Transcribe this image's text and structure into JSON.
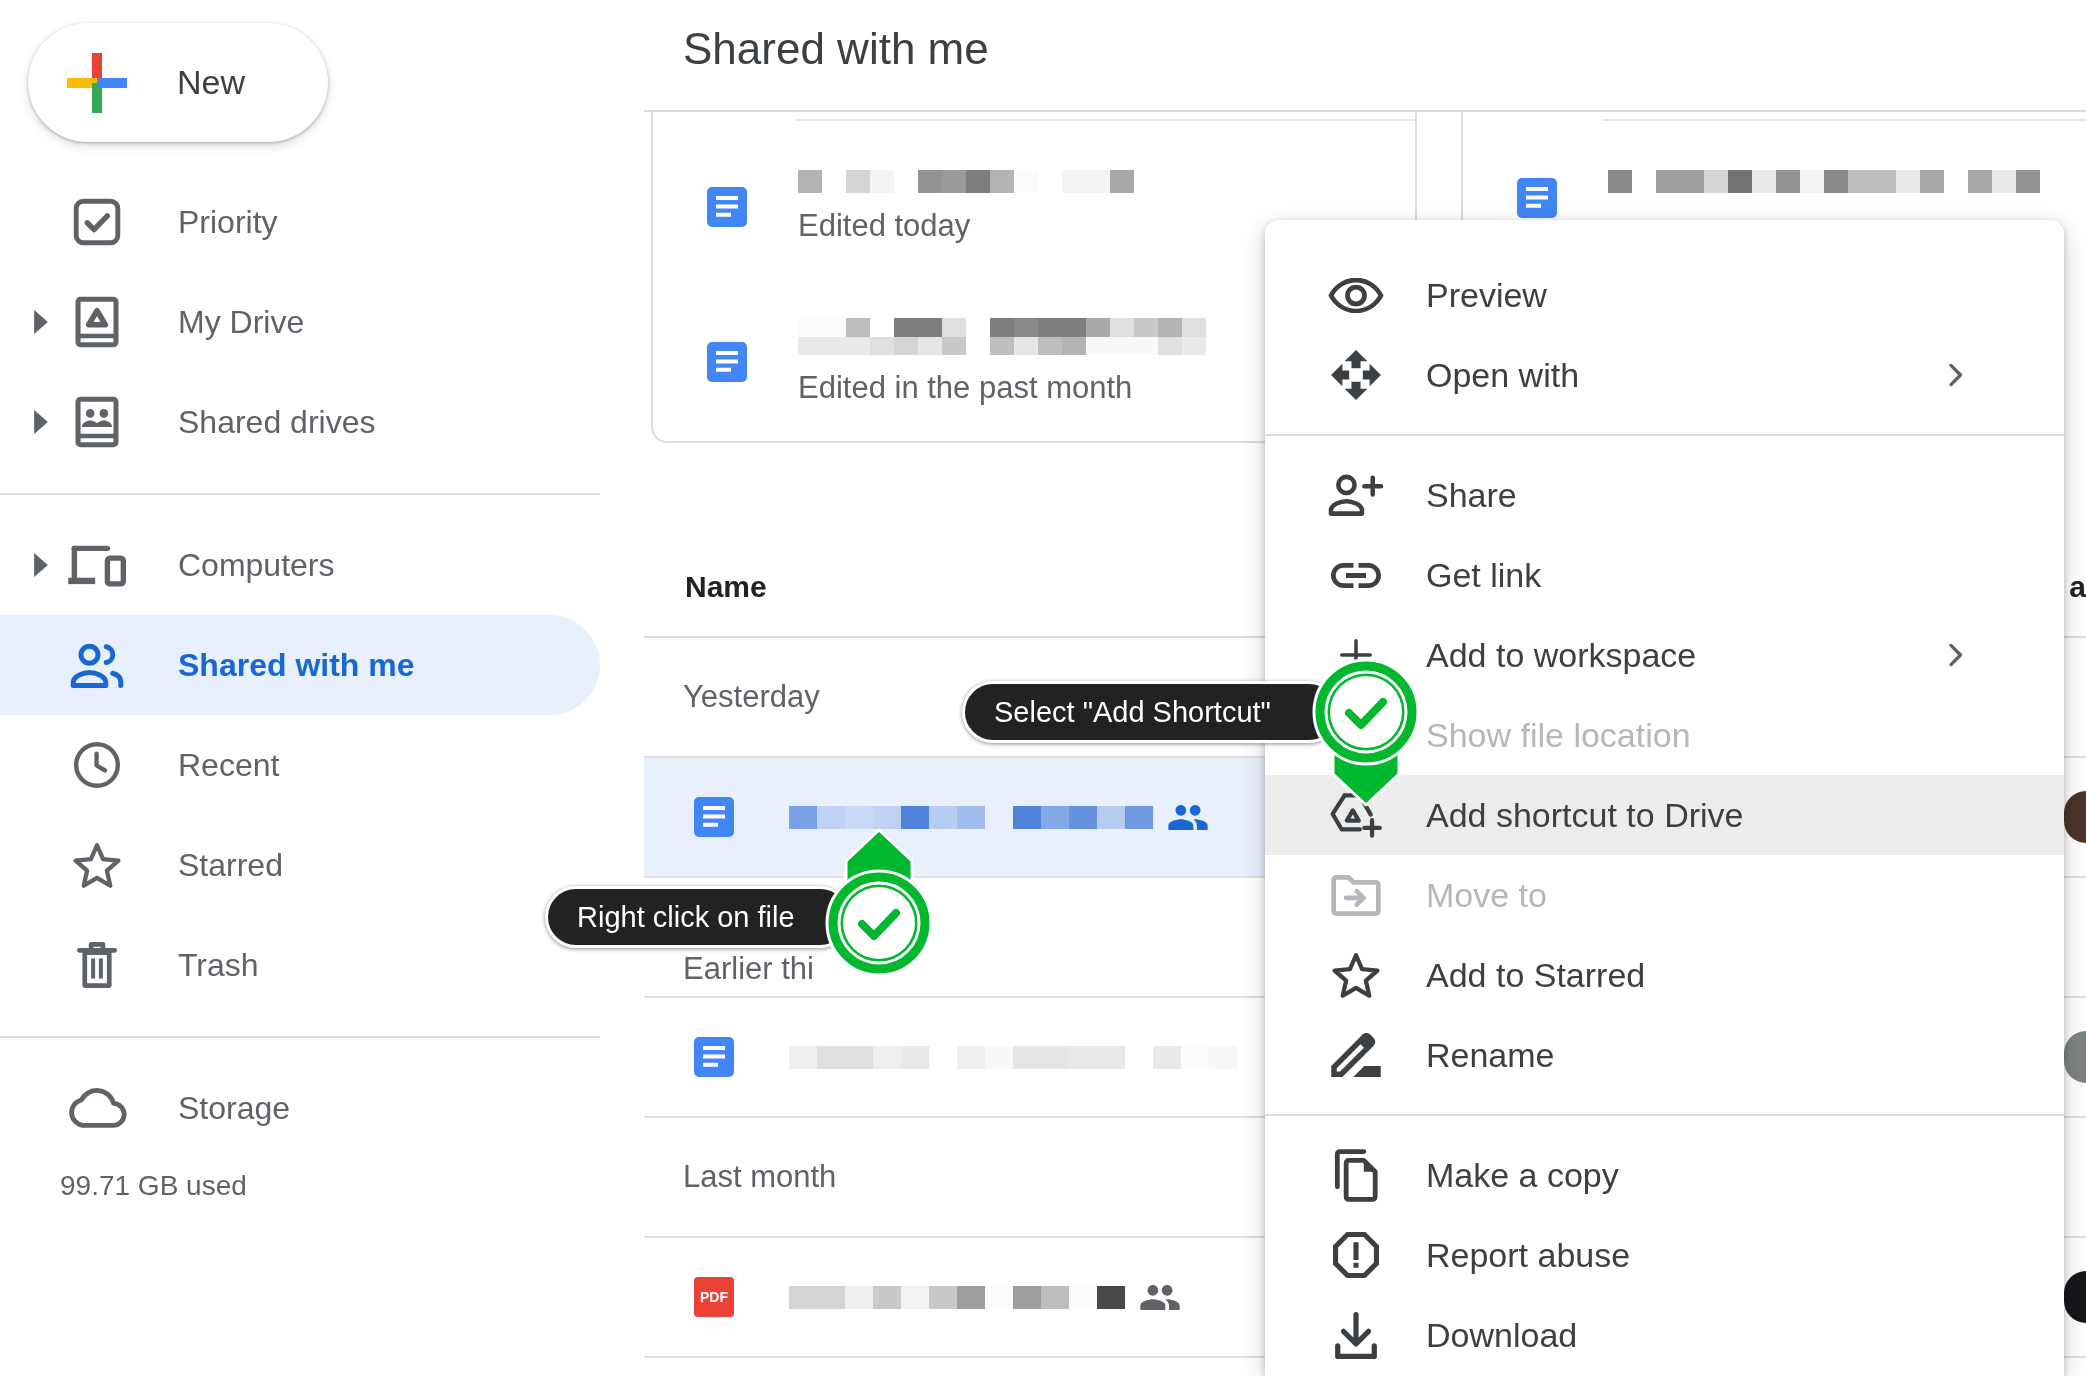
{
  "sidebar": {
    "new_button": {
      "label": "New"
    },
    "sections": [
      {
        "items": [
          {
            "label": "Priority",
            "expandable": false,
            "selected": false
          },
          {
            "label": "My Drive",
            "expandable": true,
            "selected": false
          },
          {
            "label": "Shared drives",
            "expandable": true,
            "selected": false
          }
        ]
      },
      {
        "items": [
          {
            "label": "Computers",
            "expandable": true,
            "selected": false
          },
          {
            "label": "Shared with me",
            "expandable": false,
            "selected": true
          },
          {
            "label": "Recent",
            "expandable": false,
            "selected": false
          },
          {
            "label": "Starred",
            "expandable": false,
            "selected": false
          },
          {
            "label": "Trash",
            "expandable": false,
            "selected": false
          }
        ]
      }
    ],
    "storage": {
      "label": "Storage",
      "selected": false,
      "usage": "99.71 GB used"
    }
  },
  "page_title": "Shared with me",
  "quick_access": [
    {
      "files": [
        {
          "kind": "doc",
          "subtitle": "Edited today"
        },
        {
          "kind": "doc",
          "subtitle": "Edited in the past month"
        }
      ]
    },
    {
      "files": [
        {
          "kind": "doc"
        }
      ]
    }
  ],
  "file_list": {
    "columns": [
      {
        "label": "Name"
      },
      {
        "label": "a"
      }
    ],
    "groups": [
      {
        "label": "Yesterday",
        "rows": [
          {
            "kind": "doc",
            "selected": true,
            "shared": true
          }
        ]
      },
      {
        "label": "Earlier thi",
        "rows": [
          {
            "kind": "doc",
            "selected": false,
            "shared": false
          }
        ]
      },
      {
        "label": "Last month",
        "rows": [
          {
            "kind": "pdf",
            "icon_label": "PDF",
            "selected": false,
            "shared": true
          }
        ]
      }
    ]
  },
  "context_menu": {
    "sections": [
      {
        "items": [
          {
            "label": "Preview",
            "submenu": false,
            "disabled": false,
            "highlighted": false
          },
          {
            "label": "Open with",
            "submenu": true,
            "disabled": false,
            "highlighted": false
          }
        ]
      },
      {
        "items": [
          {
            "label": "Share",
            "submenu": false,
            "disabled": false,
            "highlighted": false
          },
          {
            "label": "Get link",
            "submenu": false,
            "disabled": false,
            "highlighted": false
          },
          {
            "label": "Add to workspace",
            "submenu": true,
            "disabled": false,
            "highlighted": false
          },
          {
            "label": "Show file location",
            "submenu": false,
            "disabled": true,
            "highlighted": false
          },
          {
            "label": "Add shortcut to Drive",
            "submenu": false,
            "disabled": false,
            "highlighted": true
          },
          {
            "label": "Move to",
            "submenu": false,
            "disabled": true,
            "highlighted": false
          },
          {
            "label": "Add to Starred",
            "submenu": false,
            "disabled": false,
            "highlighted": false
          },
          {
            "label": "Rename",
            "submenu": false,
            "disabled": false,
            "highlighted": false
          }
        ]
      },
      {
        "items": [
          {
            "label": "Make a copy",
            "submenu": false,
            "disabled": false,
            "highlighted": false
          },
          {
            "label": "Report abuse",
            "submenu": false,
            "disabled": false,
            "highlighted": false
          },
          {
            "label": "Download",
            "submenu": false,
            "disabled": false,
            "highlighted": false
          }
        ]
      }
    ]
  },
  "annotations": [
    {
      "text": "Select \"Add Shortcut\"",
      "kind": "down"
    },
    {
      "text": "Right click on file",
      "kind": "up"
    }
  ]
}
